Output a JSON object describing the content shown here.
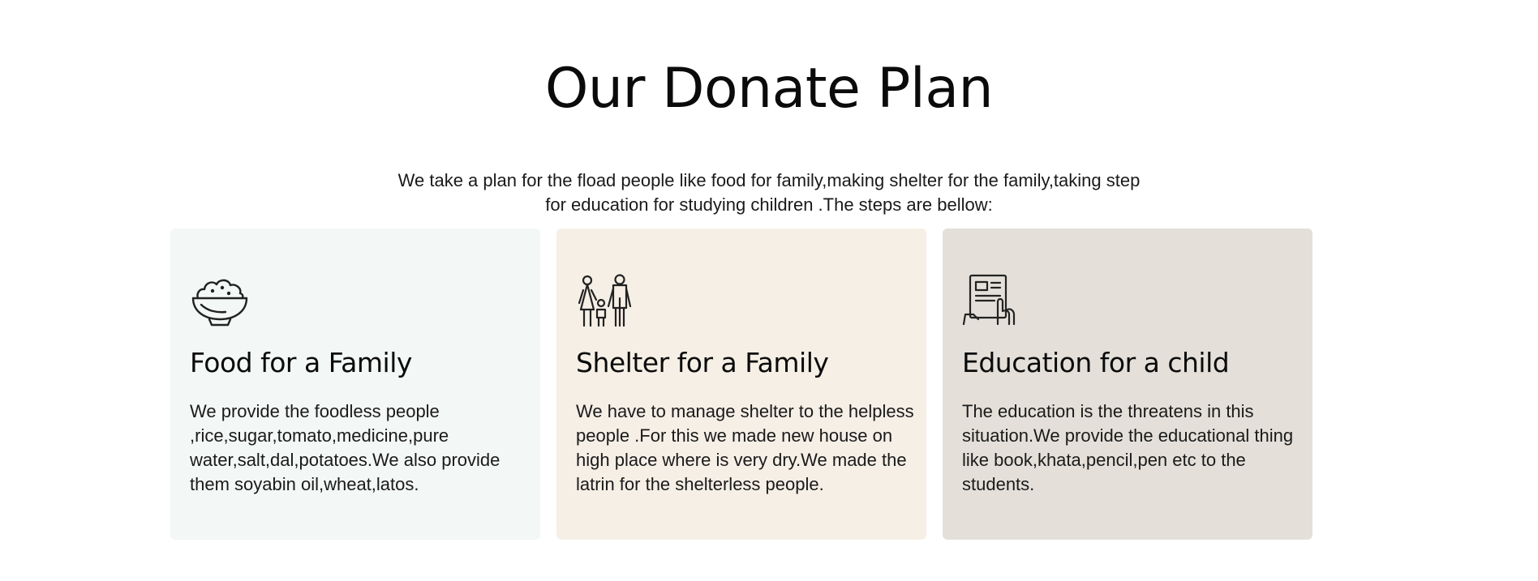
{
  "section": {
    "title": "Our Donate Plan",
    "intro": "We take a plan for the fload people like food for family,making shelter for the family,taking step for education for studying children .The steps are bellow:"
  },
  "cards": [
    {
      "icon": "food-bowl-icon",
      "title": "Food for a Family",
      "text": "We provide the foodless people ,rice,sugar,tomato,medicine,pure water,salt,dal,potatoes.We also provide them soyabin oil,wheat,latos.",
      "background": "#f3f7f5"
    },
    {
      "icon": "family-icon",
      "title": "Shelter for a Family",
      "text": "We have to manage shelter to the helpless people .For this we made new house on high place where is very dry.We made the latrin for the shelterless people.",
      "background": "#f6efe6"
    },
    {
      "icon": "education-tablet-icon",
      "title": "Education for a child",
      "text": "The education is the threatens in this situation.We provide the educational thing like book,khata,pencil,pen etc to the students.",
      "background": "#e4e0d9"
    }
  ]
}
